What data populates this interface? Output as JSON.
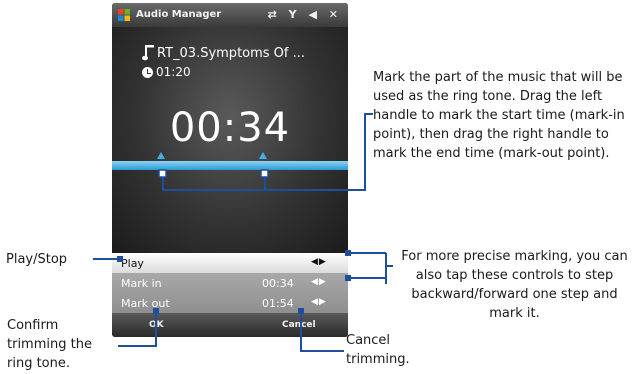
{
  "titlebar": {
    "title": "Audio Manager",
    "status_icons": "⇄ Y ◀ ✕",
    "start_icon": "windows-flag-icon"
  },
  "track": {
    "name": "RT_03.Symptoms Of ...",
    "elapsed": "01:20",
    "current_time": "00:34"
  },
  "trim": {
    "mark_in_fraction": 0.208,
    "mark_out_fraction": 0.64
  },
  "menu": {
    "rows": [
      {
        "label": "Play",
        "value": "",
        "arrows": "◀▶"
      },
      {
        "label": "Mark in",
        "value": "00:34",
        "arrows": "◀▶"
      },
      {
        "label": "Mark out",
        "value": "01:54",
        "arrows": "◀▶"
      }
    ]
  },
  "softkeys": {
    "left": "OK",
    "right": "Cancel"
  },
  "callouts": {
    "mark_info": "Mark the part of the music that will be used as the ring tone. Drag the left handle to mark the start time (mark-in point), then drag the right handle to mark the end time (mark-out point).",
    "precise": "For more precise marking, you can also tap these controls to step backward/forward one step and mark it.",
    "play_stop": "Play/Stop",
    "confirm": "Confirm trimming the ring tone.",
    "cancel": "Cancel trimming."
  },
  "colors": {
    "accent": "#1e4f9c",
    "progress": "#3fb0e6"
  }
}
